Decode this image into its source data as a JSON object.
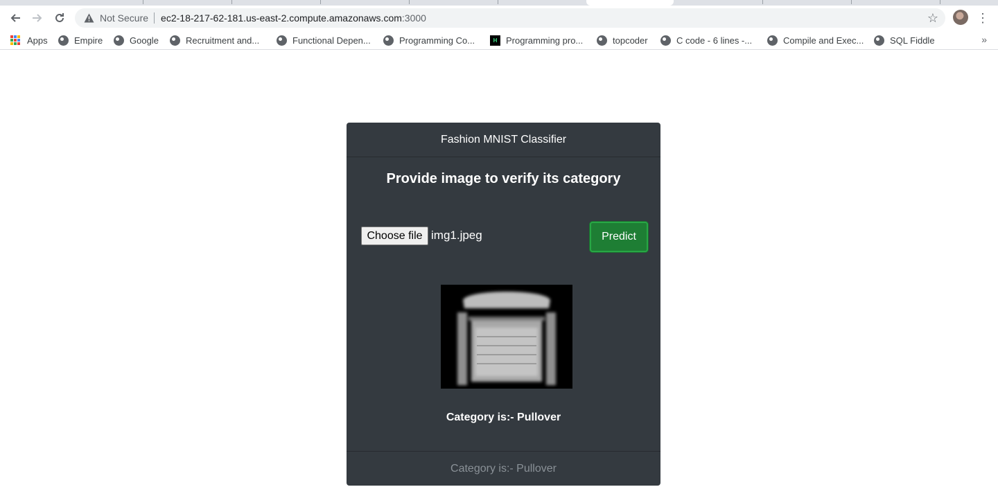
{
  "browser": {
    "omnibox": {
      "security_label": "Not Secure",
      "url_host": "ec2-18-217-62-181.us-east-2.compute.amazonaws.com",
      "url_port": ":3000"
    },
    "bookmarks": [
      {
        "label": "Apps",
        "icon": "apps-grid-icon"
      },
      {
        "label": "Empire",
        "icon": "globe-icon"
      },
      {
        "label": "Google",
        "icon": "globe-icon"
      },
      {
        "label": "Recruitment and...",
        "icon": "globe-icon"
      },
      {
        "label": "Functional Depen...",
        "icon": "globe-icon"
      },
      {
        "label": "Programming Co...",
        "icon": "globe-icon"
      },
      {
        "label": "Programming pro...",
        "icon": "hackerrank-icon"
      },
      {
        "label": "topcoder",
        "icon": "globe-icon"
      },
      {
        "label": "C code - 6 lines -...",
        "icon": "globe-icon"
      },
      {
        "label": "Compile and Exec...",
        "icon": "globe-icon"
      },
      {
        "label": "SQL Fiddle",
        "icon": "globe-icon"
      }
    ],
    "more_bookmarks": "»"
  },
  "app": {
    "header": "Fashion MNIST Classifier",
    "title": "Provide image to verify its category",
    "file_button_label": "Choose file",
    "file_name": "img1.jpeg",
    "predict_label": "Predict",
    "result_text": "Category is:- Pullover",
    "footer_text": "Category is:- Pullover"
  },
  "colors": {
    "card_bg": "#343a40",
    "predict_bg": "#1e7e34",
    "predict_border": "#28a745",
    "footer_text": "#8a9197"
  }
}
